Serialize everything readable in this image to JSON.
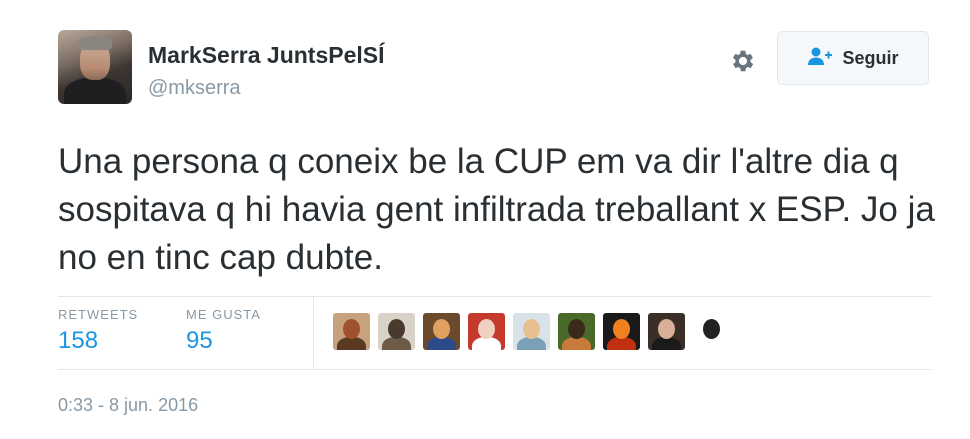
{
  "user": {
    "display_name": "MarkSerra JuntsPelSÍ",
    "screen_name": "@mkserra"
  },
  "actions": {
    "follow_label": "Seguir"
  },
  "tweet": {
    "text": "Una persona q coneix be la CUP em va dir l'altre dia q sospitava q hi havia gent infiltrada treballant x ESP. Jo ja no en tinc cap dubte.",
    "timestamp": "0:33 - 8 jun. 2016"
  },
  "stats": {
    "retweets_label": "RETWEETS",
    "retweets_count": "158",
    "likes_label": "ME GUSTA",
    "likes_count": "95"
  },
  "likers": [
    {
      "icon": "user-avatar-icon",
      "bg": "#c8a27c",
      "head": "#a0522d",
      "body": "#5a3a22"
    },
    {
      "icon": "user-avatar-icon",
      "bg": "#d8d2c8",
      "head": "#4a3a2e",
      "body": "#6d5b48"
    },
    {
      "icon": "user-avatar-icon",
      "bg": "#6a4a2a",
      "head": "#e0a060",
      "body": "#2a4a8a"
    },
    {
      "icon": "user-avatar-icon",
      "bg": "#c63a2e",
      "head": "#f0d0c0",
      "body": "#ffffff"
    },
    {
      "icon": "user-avatar-icon",
      "bg": "#d9e2e8",
      "head": "#e8c090",
      "body": "#7aa0b8"
    },
    {
      "icon": "user-avatar-icon",
      "bg": "#4a6a2a",
      "head": "#3a2a1a",
      "body": "#c87a3a"
    },
    {
      "icon": "user-avatar-icon",
      "bg": "#1a1a1a",
      "head": "#f08020",
      "body": "#c03010"
    },
    {
      "icon": "user-avatar-icon",
      "bg": "#3a2e26",
      "head": "#d8b098",
      "body": "#1a1a1a"
    },
    {
      "icon": "sketch-avatar-icon",
      "bg": "#ffffff",
      "head": "#222222",
      "body": "#ffffff"
    }
  ],
  "colors": {
    "accent": "#1b95e0",
    "muted": "#8899a6",
    "text": "#292f33",
    "border": "#e1e8ed"
  }
}
